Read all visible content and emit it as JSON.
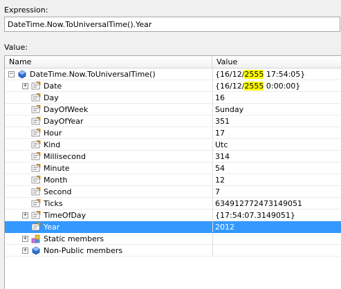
{
  "expression_label": "Expression:",
  "expression_value": "DateTime.Now.ToUniversalTime().Year",
  "value_label": "Value:",
  "columns": {
    "name": "Name",
    "value": "Value"
  },
  "root": {
    "name": "DateTime.Now.ToUniversalTime()",
    "value_parts": [
      "{16/12/",
      "2555",
      " 17:54:05}"
    ],
    "expander": "−"
  },
  "rows": [
    {
      "name": "Date",
      "value_parts": [
        "{16/12/",
        "2555",
        " 0:00:00}"
      ],
      "expander": "+",
      "icon": "property-icon"
    },
    {
      "name": "Day",
      "value": "16",
      "icon": "property-icon"
    },
    {
      "name": "DayOfWeek",
      "value": "Sunday",
      "icon": "property-icon"
    },
    {
      "name": "DayOfYear",
      "value": "351",
      "icon": "property-icon"
    },
    {
      "name": "Hour",
      "value": "17",
      "icon": "property-icon"
    },
    {
      "name": "Kind",
      "value": "Utc",
      "icon": "property-icon"
    },
    {
      "name": "Millisecond",
      "value": "314",
      "icon": "property-icon"
    },
    {
      "name": "Minute",
      "value": "54",
      "icon": "property-icon"
    },
    {
      "name": "Month",
      "value": "12",
      "icon": "property-icon"
    },
    {
      "name": "Second",
      "value": "7",
      "icon": "property-icon"
    },
    {
      "name": "Ticks",
      "value": "634912772473149051",
      "icon": "property-icon"
    },
    {
      "name": "TimeOfDay",
      "value": "{17:54:07.3149051}",
      "expander": "+",
      "icon": "property-icon"
    },
    {
      "name": "Year",
      "value": "2012",
      "icon": "property-icon",
      "selected": true
    },
    {
      "name": "Static members",
      "value": "",
      "expander": "+",
      "icon": "static-members-icon"
    },
    {
      "name": "Non-Public members",
      "value": "",
      "expander": "+",
      "icon": "non-public-members-icon"
    }
  ],
  "colors": {
    "selection": "#3399ff",
    "highlight": "#ffff00"
  }
}
